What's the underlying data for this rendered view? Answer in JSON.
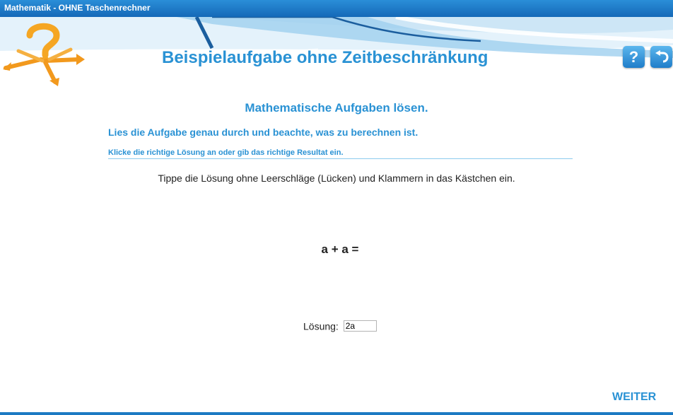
{
  "window": {
    "title": "Mathematik - OHNE Taschenrechner"
  },
  "header": {
    "title": "Beispielaufgabe ohne Zeitbeschränkung",
    "help_label": "?",
    "logo_icon": "question-arrows-logo",
    "back_icon": "undo-arrow-icon"
  },
  "task": {
    "subtitle": "Mathematische Aufgaben lösen.",
    "instruction_read": "Lies die Aufgabe genau durch und beachte, was zu berechnen ist.",
    "instruction_click": "Klicke die richtige Lösung an oder gib das richtige Resultat ein.",
    "hint": "Tippe die Lösung ohne Leerschläge (Lücken) und Klammern in das Kästchen ein.",
    "expression": "a + a =",
    "answer_label": "Lösung:",
    "answer_value": "2a"
  },
  "footer": {
    "next_label": "WEITER"
  },
  "colors": {
    "accent": "#2a92d4",
    "titlebar": "#1a73c2",
    "logo_orange": "#f5a623"
  }
}
